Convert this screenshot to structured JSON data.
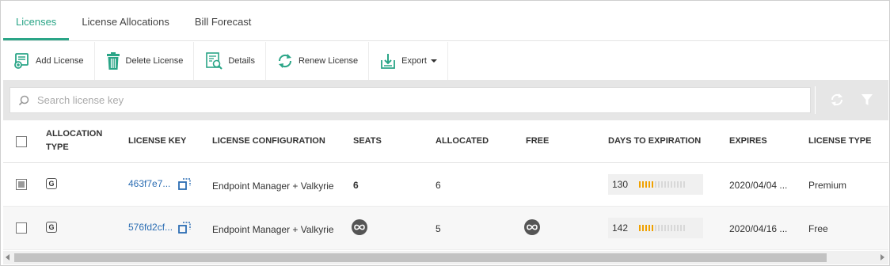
{
  "tabs": [
    {
      "label": "Licenses"
    },
    {
      "label": "License Allocations"
    },
    {
      "label": "Bill Forecast"
    }
  ],
  "toolbar": {
    "add_license": "Add License",
    "delete_license": "Delete License",
    "details": "Details",
    "renew_license": "Renew License",
    "export": "Export"
  },
  "search": {
    "placeholder": "Search license key",
    "value": ""
  },
  "table": {
    "headers": {
      "allocation_type": "Allocation Type",
      "license_key": "License Key",
      "license_configuration": "License Configuration",
      "seats": "Seats",
      "allocated": "Allocated",
      "free": "Free",
      "days_to_expiration": "Days to Expiration",
      "expires": "Expires",
      "license_type": "License Type"
    },
    "rows": [
      {
        "checked": true,
        "allocation_badge": "G",
        "license_key": "463f7e7...",
        "configuration": "Endpoint Manager + Valkyrie",
        "seats": "6",
        "allocated": "6",
        "free": "",
        "days": "130",
        "days_fraction": 0.36,
        "expires": "2020/04/04 ...",
        "license_type": "Premium"
      },
      {
        "checked": false,
        "allocation_badge": "G",
        "license_key": "576fd2cf...",
        "configuration": "Endpoint Manager + Valkyrie",
        "seats": "",
        "allocated": "5",
        "free": "",
        "days": "142",
        "days_fraction": 0.36,
        "expires": "2020/04/16 ...",
        "license_type": "Free"
      }
    ]
  },
  "colors": {
    "accent": "#2aa587",
    "link": "#2b6db3",
    "progress": "#f0a100"
  },
  "icons": [
    "add-license-icon",
    "trash-icon",
    "details-icon",
    "refresh-icon",
    "export-icon",
    "search-icon",
    "filter-icon",
    "copy-icon",
    "infinity-icon"
  ]
}
